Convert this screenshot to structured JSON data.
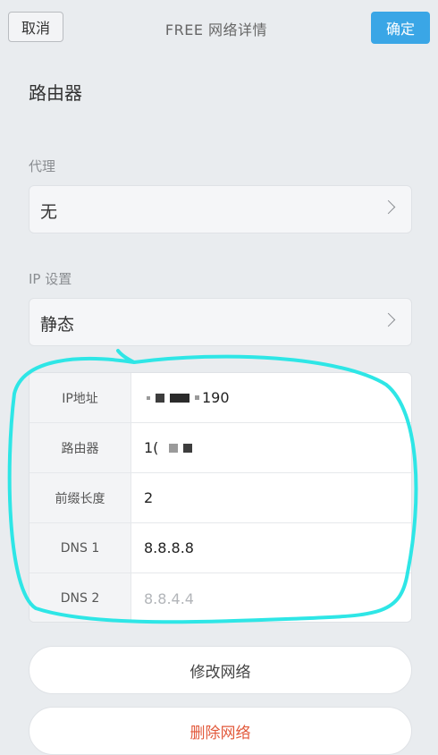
{
  "header": {
    "cancel_label": "取消",
    "title": "FREE 网络详情",
    "confirm_label": "确定"
  },
  "router_section": {
    "title": "路由器"
  },
  "proxy": {
    "label": "代理",
    "value": "无"
  },
  "ip_settings": {
    "label": "IP 设置",
    "value": "静态"
  },
  "network_table": {
    "rows": [
      {
        "label": "IP地址",
        "value": "190"
      },
      {
        "label": "路由器",
        "value": "1("
      },
      {
        "label": "前缀长度",
        "value": "2"
      },
      {
        "label": "DNS 1",
        "value": "8.8.8.8"
      },
      {
        "label": "DNS 2",
        "value": "8.8.4.4"
      }
    ]
  },
  "actions": {
    "modify_label": "修改网络",
    "delete_label": "删除网络"
  },
  "colors": {
    "accent": "#3aa6e6",
    "annotation": "#2ee6e6",
    "danger": "#e25a3c"
  }
}
